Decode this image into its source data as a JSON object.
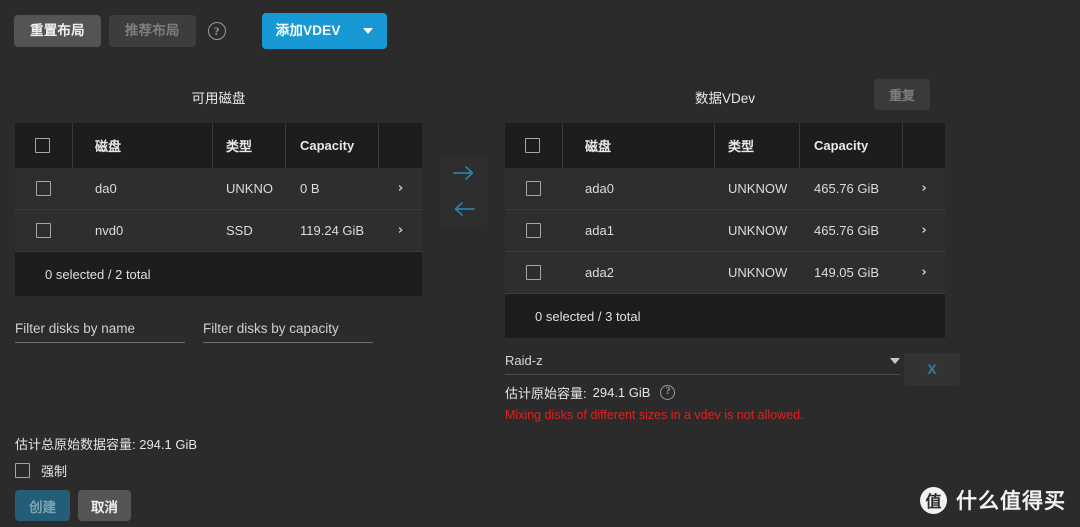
{
  "toolbar": {
    "reset_layout": "重置布局",
    "suggest_layout": "推荐布局",
    "help_icon": "help-circle-icon",
    "add_vdev": "添加VDEV",
    "caret_icon": "chevron-down-icon"
  },
  "left_panel": {
    "title": "可用磁盘",
    "columns": [
      "",
      "磁盘",
      "类型",
      "Capacity",
      ""
    ],
    "rows": [
      {
        "name": "da0",
        "type": "UNKNO",
        "capacity": "0 B",
        "chevron": "chevron-right-icon"
      },
      {
        "name": "nvd0",
        "type": "SSD",
        "capacity": "119.24 GiB",
        "chevron": "chevron-right-icon"
      }
    ],
    "footer": "0 selected / 2 total"
  },
  "right_panel": {
    "title": "数据VDev",
    "duplicate_button": "重复",
    "columns": [
      "",
      "磁盘",
      "类型",
      "Capacity",
      ""
    ],
    "rows": [
      {
        "name": "ada0",
        "type": "UNKNOW",
        "capacity": "465.76 GiB",
        "chevron": "chevron-right-icon"
      },
      {
        "name": "ada1",
        "type": "UNKNOW",
        "capacity": "465.76 GiB",
        "chevron": "chevron-right-icon"
      },
      {
        "name": "ada2",
        "type": "UNKNOW",
        "capacity": "149.05 GiB",
        "chevron": "chevron-right-icon"
      }
    ],
    "footer": "0 selected / 3 total"
  },
  "transfer": {
    "move_right_icon": "arrow-right-icon",
    "move_left_icon": "arrow-left-icon"
  },
  "filters": {
    "name_placeholder": "Filter disks by name",
    "name_value": "",
    "capacity_placeholder": "Filter disks by capacity",
    "capacity_value": ""
  },
  "vdev_config": {
    "layout_label": "Raid-z",
    "layout_caret_icon": "chevron-down-icon",
    "estimated_raw_label": "估计原始容量:",
    "estimated_raw_value": "294.1 GiB",
    "estimated_help_icon": "help-circle-icon",
    "error_message": "Mixing disks of different sizes in a vdev is not allowed.",
    "remove_button": "X"
  },
  "footer": {
    "total_raw_capacity": "估计总原始数据容量: 294.1 GiB",
    "force_label": "强制",
    "force_checked": false,
    "create_button": "创建",
    "cancel_button": "取消"
  },
  "watermark": {
    "badge": "值",
    "text": "什么值得买"
  },
  "colors": {
    "page_bg": "#2b2b2b",
    "table_row_bg": "#2e2e2e",
    "table_header_bg": "#1d1d1d",
    "accent_blue": "#1899d6",
    "create_blue": "#235d78",
    "error_red": "#e02020",
    "arrow_blue": "#2d7fa3"
  }
}
